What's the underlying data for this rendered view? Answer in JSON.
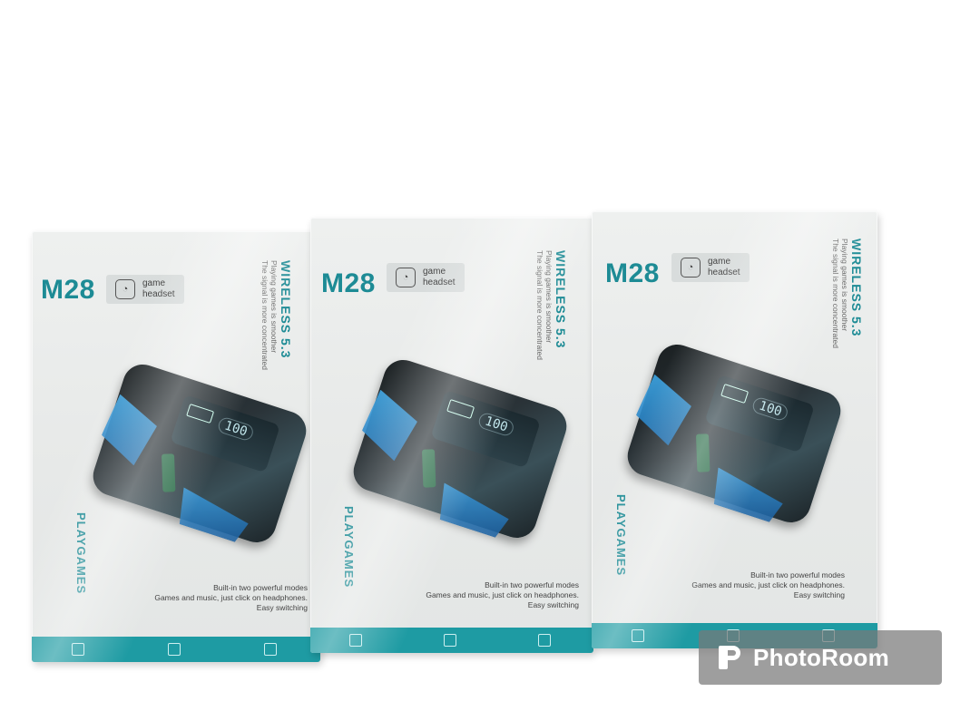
{
  "product": {
    "model": "M28",
    "tag_text": "game\nheadset",
    "wireless_title": "WIRELESS 5.3",
    "wireless_sub1": "Playing games is smoother",
    "wireless_sub2": "The signal is more concentrated",
    "side_brand": "PLAYGAMES",
    "desc_line1": "Built-in two powerful modes",
    "desc_line2": "Games and music, just click on headphones.",
    "desc_line3": "Easy switching",
    "case_display": "100"
  },
  "watermark": {
    "text": "PhotoRoom",
    "icon": "photoroom-logo-icon"
  },
  "colors": {
    "brand_teal": "#1d8b95",
    "strip_teal": "#1e9ba3",
    "box_white": "#e9ebea"
  }
}
